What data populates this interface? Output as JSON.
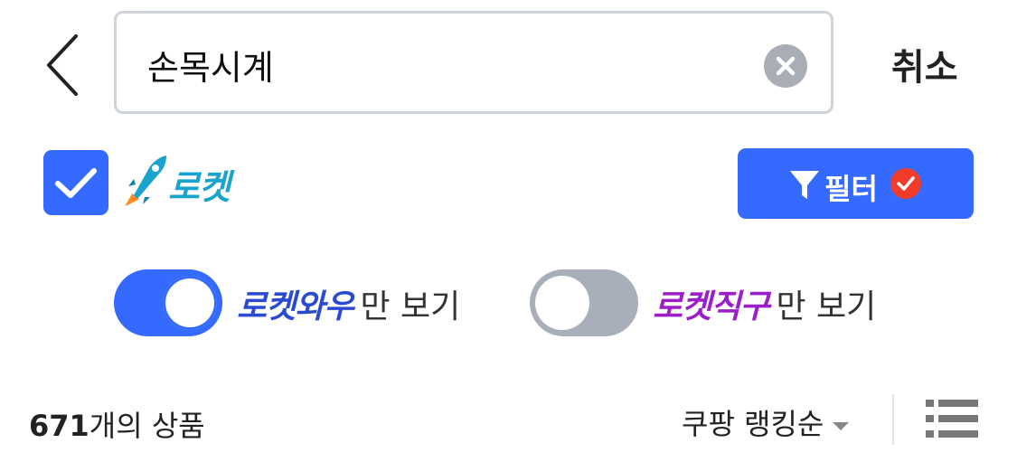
{
  "header": {
    "search": {
      "value": "손목시계",
      "placeholder": ""
    },
    "cancel_label": "취소",
    "icons": {
      "back": "chevron-left-icon",
      "clear": "clear-circle-icon"
    }
  },
  "rocket_filter": {
    "checked": true,
    "label": "로켓",
    "icon": "rocket-icon"
  },
  "filter_button": {
    "label": "필터",
    "icons": [
      "funnel-icon",
      "check-badge-icon"
    ]
  },
  "toggles": [
    {
      "brand": "로켓와우",
      "suffix": "만 보기",
      "on": true,
      "brand_color": "#2a4bd0"
    },
    {
      "brand": "로켓직구",
      "suffix": "만 보기",
      "on": false,
      "brand_color": "#9b1ec9"
    }
  ],
  "results": {
    "count": "671",
    "count_suffix": "개의 상품",
    "sort_label": "쿠팡 랭킹순",
    "view_icon": "list-view-icon"
  },
  "colors": {
    "accent": "#346aff",
    "rocket_text": "#1aa3cc",
    "badge_red": "#f23c2b",
    "toggle_off": "#a9afba"
  }
}
